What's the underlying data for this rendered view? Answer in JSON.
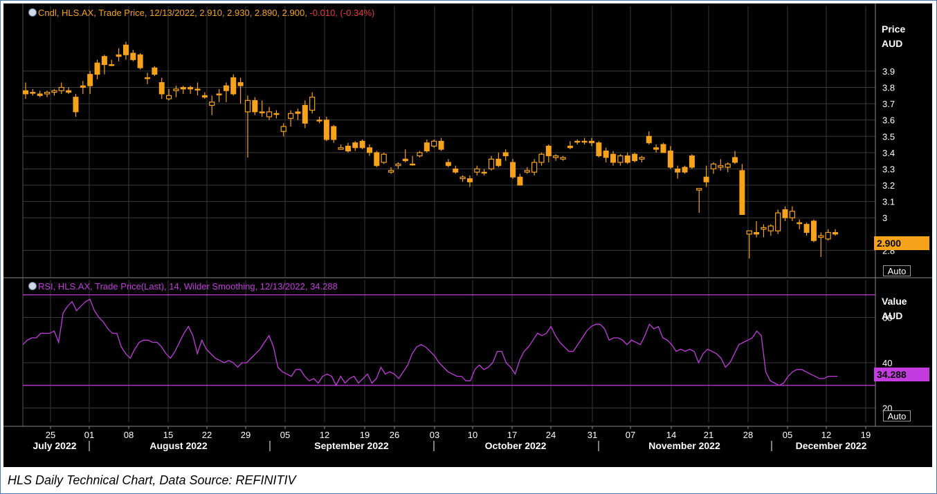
{
  "caption": "HLS Daily Technical Chart, Data Source: REFINITIV",
  "price_panel": {
    "legend_prefix": "Cndl, HLS.AX, Trade Price, 12/13/2022, 2.910, 2.930, 2.890, 2.900, ",
    "legend_change": "-0.010, (-0.34%)",
    "axis_title_line1": "Price",
    "axis_title_line2": "AUD",
    "last_value": "2.900",
    "auto_label": "Auto"
  },
  "rsi_panel": {
    "legend": "RSI, HLS.AX, Trade Price(Last), 14, Wilder Smoothing, 12/13/2022, 34.288",
    "axis_title_line1": "Value",
    "axis_title_line2": "AUD",
    "last_value": "34.288",
    "auto_label": "Auto"
  },
  "colors": {
    "background": "#000000",
    "grid": "#3a3a3a",
    "candle": "#f7a21b",
    "rsi_line": "#c43be0",
    "legend_price": "#f7a21b",
    "legend_change": "#e8393a",
    "legend_rsi": "#c43be0",
    "axis_text": "#ffffff"
  },
  "chart_data": [
    {
      "type": "candlestick",
      "title": "Cndl, HLS.AX, Trade Price",
      "ylabel": "Price AUD",
      "ylim": [
        2.72,
        4.11
      ],
      "y_ticks": [
        "2.8",
        "3",
        "3.1",
        "3.2",
        "3.3",
        "3.4",
        "3.5",
        "3.6",
        "3.7",
        "3.8",
        "3.9"
      ],
      "x_ticks": [
        "25",
        "01",
        "08",
        "15",
        "22",
        "29",
        "05",
        "12",
        "19",
        "26",
        "03",
        "10",
        "17",
        "24",
        "31",
        "07",
        "14",
        "21",
        "28",
        "05",
        "12",
        "19"
      ],
      "month_labels": [
        "July 2022",
        "August 2022",
        "September 2022",
        "October 2022",
        "November 2022",
        "December 2022"
      ],
      "grid": true,
      "candles": [
        [
          3.78,
          3.83,
          3.73,
          3.76
        ],
        [
          3.77,
          3.79,
          3.75,
          3.77
        ],
        [
          3.76,
          3.78,
          3.74,
          3.75
        ],
        [
          3.76,
          3.78,
          3.74,
          3.77
        ],
        [
          3.77,
          3.79,
          3.75,
          3.78
        ],
        [
          3.78,
          3.83,
          3.76,
          3.8
        ],
        [
          3.78,
          3.8,
          3.76,
          3.77
        ],
        [
          3.74,
          3.76,
          3.62,
          3.65
        ],
        [
          3.81,
          3.84,
          3.76,
          3.8
        ],
        [
          3.88,
          3.9,
          3.76,
          3.81
        ],
        [
          3.95,
          3.97,
          3.85,
          3.88
        ],
        [
          3.99,
          4.0,
          3.88,
          3.94
        ],
        [
          3.94,
          3.97,
          3.93,
          3.94
        ],
        [
          4.0,
          4.04,
          3.96,
          3.99
        ],
        [
          4.06,
          4.08,
          3.97,
          4.0
        ],
        [
          4.01,
          4.03,
          3.96,
          3.97
        ],
        [
          4.0,
          4.01,
          3.91,
          3.92
        ],
        [
          3.86,
          3.89,
          3.82,
          3.86
        ],
        [
          3.92,
          3.93,
          3.87,
          3.88
        ],
        [
          3.83,
          3.86,
          3.73,
          3.76
        ],
        [
          3.73,
          3.79,
          3.72,
          3.75
        ],
        [
          3.78,
          3.81,
          3.74,
          3.79
        ],
        [
          3.8,
          3.81,
          3.76,
          3.79
        ],
        [
          3.8,
          3.81,
          3.76,
          3.79
        ],
        [
          3.79,
          3.83,
          3.75,
          3.79
        ],
        [
          3.75,
          3.77,
          3.73,
          3.74
        ],
        [
          3.69,
          3.75,
          3.63,
          3.71
        ],
        [
          3.76,
          3.79,
          3.71,
          3.76
        ],
        [
          3.81,
          3.83,
          3.71,
          3.78
        ],
        [
          3.86,
          3.88,
          3.75,
          3.76
        ],
        [
          3.83,
          3.86,
          3.7,
          3.81
        ],
        [
          3.65,
          3.75,
          3.37,
          3.72
        ],
        [
          3.72,
          3.74,
          3.63,
          3.65
        ],
        [
          3.65,
          3.72,
          3.62,
          3.65
        ],
        [
          3.62,
          3.68,
          3.6,
          3.65
        ],
        [
          3.64,
          3.66,
          3.61,
          3.64
        ],
        [
          3.53,
          3.58,
          3.5,
          3.56
        ],
        [
          3.61,
          3.66,
          3.56,
          3.64
        ],
        [
          3.65,
          3.67,
          3.6,
          3.64
        ],
        [
          3.69,
          3.72,
          3.55,
          3.58
        ],
        [
          3.66,
          3.77,
          3.64,
          3.74
        ],
        [
          3.6,
          3.62,
          3.58,
          3.6
        ],
        [
          3.6,
          3.62,
          3.47,
          3.48
        ],
        [
          3.56,
          3.57,
          3.46,
          3.48
        ],
        [
          3.42,
          3.45,
          3.42,
          3.43
        ],
        [
          3.44,
          3.46,
          3.4,
          3.41
        ],
        [
          3.46,
          3.47,
          3.41,
          3.43
        ],
        [
          3.47,
          3.48,
          3.42,
          3.43
        ],
        [
          3.43,
          3.45,
          3.38,
          3.4
        ],
        [
          3.4,
          3.41,
          3.31,
          3.32
        ],
        [
          3.34,
          3.4,
          3.33,
          3.39
        ],
        [
          3.28,
          3.31,
          3.27,
          3.29
        ],
        [
          3.32,
          3.34,
          3.3,
          3.33
        ],
        [
          3.36,
          3.42,
          3.34,
          3.35
        ],
        [
          3.33,
          3.38,
          3.32,
          3.33
        ],
        [
          3.38,
          3.41,
          3.37,
          3.4
        ],
        [
          3.46,
          3.48,
          3.4,
          3.41
        ],
        [
          3.44,
          3.48,
          3.43,
          3.47
        ],
        [
          3.47,
          3.49,
          3.41,
          3.42
        ],
        [
          3.34,
          3.36,
          3.31,
          3.32
        ],
        [
          3.3,
          3.32,
          3.27,
          3.28
        ],
        [
          3.24,
          3.26,
          3.22,
          3.25
        ],
        [
          3.24,
          3.26,
          3.19,
          3.22
        ],
        [
          3.28,
          3.32,
          3.26,
          3.3
        ],
        [
          3.28,
          3.3,
          3.26,
          3.28
        ],
        [
          3.3,
          3.38,
          3.29,
          3.36
        ],
        [
          3.36,
          3.4,
          3.31,
          3.32
        ],
        [
          3.4,
          3.42,
          3.35,
          3.38
        ],
        [
          3.34,
          3.36,
          3.24,
          3.25
        ],
        [
          3.25,
          3.27,
          3.2,
          3.2
        ],
        [
          3.28,
          3.31,
          3.27,
          3.29
        ],
        [
          3.28,
          3.36,
          3.26,
          3.34
        ],
        [
          3.34,
          3.4,
          3.32,
          3.39
        ],
        [
          3.44,
          3.45,
          3.34,
          3.38
        ],
        [
          3.37,
          3.39,
          3.35,
          3.38
        ],
        [
          3.36,
          3.38,
          3.35,
          3.37
        ],
        [
          3.44,
          3.47,
          3.42,
          3.43
        ],
        [
          3.47,
          3.48,
          3.45,
          3.47
        ],
        [
          3.47,
          3.49,
          3.45,
          3.47
        ],
        [
          3.47,
          3.49,
          3.44,
          3.46
        ],
        [
          3.46,
          3.47,
          3.37,
          3.38
        ],
        [
          3.41,
          3.43,
          3.34,
          3.37
        ],
        [
          3.39,
          3.41,
          3.32,
          3.34
        ],
        [
          3.34,
          3.39,
          3.32,
          3.38
        ],
        [
          3.38,
          3.4,
          3.33,
          3.34
        ],
        [
          3.39,
          3.4,
          3.34,
          3.35
        ],
        [
          3.36,
          3.38,
          3.34,
          3.37
        ],
        [
          3.5,
          3.53,
          3.45,
          3.46
        ],
        [
          3.43,
          3.45,
          3.4,
          3.42
        ],
        [
          3.45,
          3.46,
          3.4,
          3.4
        ],
        [
          3.41,
          3.44,
          3.3,
          3.31
        ],
        [
          3.3,
          3.32,
          3.24,
          3.28
        ],
        [
          3.31,
          3.32,
          3.27,
          3.28
        ],
        [
          3.38,
          3.39,
          3.3,
          3.31
        ],
        [
          3.17,
          3.18,
          3.03,
          3.18
        ],
        [
          3.25,
          3.32,
          3.19,
          3.22
        ],
        [
          3.3,
          3.34,
          3.27,
          3.33
        ],
        [
          3.31,
          3.36,
          3.29,
          3.32
        ],
        [
          3.31,
          3.34,
          3.28,
          3.33
        ],
        [
          3.37,
          3.41,
          3.33,
          3.34
        ],
        [
          3.29,
          3.33,
          3.02,
          3.02
        ],
        [
          2.9,
          2.92,
          2.75,
          2.92
        ],
        [
          2.91,
          2.98,
          2.88,
          2.9
        ],
        [
          2.93,
          2.96,
          2.88,
          2.94
        ],
        [
          2.92,
          2.96,
          2.89,
          2.95
        ],
        [
          2.92,
          3.05,
          2.9,
          3.03
        ],
        [
          3.05,
          3.07,
          2.98,
          3.0
        ],
        [
          3.0,
          3.07,
          2.98,
          3.04
        ],
        [
          2.97,
          2.99,
          2.93,
          2.97
        ],
        [
          2.96,
          2.97,
          2.89,
          2.91
        ],
        [
          2.98,
          2.99,
          2.85,
          2.86
        ],
        [
          2.88,
          2.91,
          2.76,
          2.89
        ],
        [
          2.87,
          2.93,
          2.86,
          2.91
        ],
        [
          2.91,
          2.93,
          2.89,
          2.9
        ]
      ]
    },
    {
      "type": "line",
      "title": "RSI, HLS.AX, Trade Price(Last), 14, Wilder Smoothing",
      "ylabel": "Value AUD",
      "ylim": [
        4,
        76
      ],
      "y_ticks": [
        "20",
        "40",
        "60"
      ],
      "reference_lines": [
        70,
        30
      ],
      "series": [
        {
          "name": "RSI",
          "values": [
            48,
            50,
            51,
            51,
            53,
            53,
            53,
            54,
            49,
            62,
            65,
            67,
            63,
            65,
            67,
            68,
            63,
            60,
            58,
            55,
            53,
            53,
            47,
            44,
            42,
            46,
            49,
            50,
            50,
            49,
            49,
            47,
            44,
            42,
            45,
            49,
            53,
            56,
            52,
            44,
            50,
            46,
            44,
            42,
            41,
            40,
            41,
            40,
            38,
            40,
            40,
            42,
            44,
            46,
            49,
            52,
            47,
            38,
            36,
            35,
            34,
            37,
            37,
            34,
            32,
            33,
            31,
            34,
            35,
            34,
            30,
            34,
            31,
            33,
            34,
            31,
            33,
            35,
            31,
            33,
            38,
            35,
            36,
            35,
            33,
            36,
            39,
            44,
            47,
            48,
            47,
            45,
            43,
            40,
            38,
            36,
            35,
            34,
            34,
            32,
            32,
            37,
            39,
            37,
            38,
            40,
            45,
            45,
            40,
            38,
            35,
            41,
            45,
            47,
            50,
            53,
            52,
            53,
            56,
            52,
            49,
            47,
            45,
            45,
            48,
            51,
            54,
            56,
            57,
            57,
            55,
            50,
            51,
            51,
            50,
            48,
            50,
            49,
            48,
            52,
            57,
            55,
            56,
            51,
            50,
            48,
            45,
            46,
            45,
            46,
            45,
            40,
            44,
            46,
            45,
            44,
            42,
            38,
            40,
            44,
            48,
            49,
            50,
            51,
            54,
            52,
            36,
            32,
            31,
            30,
            31,
            34,
            36,
            37,
            37,
            36,
            35,
            34,
            33,
            33,
            34,
            34,
            34
          ],
          "last": 34.288
        }
      ]
    }
  ]
}
